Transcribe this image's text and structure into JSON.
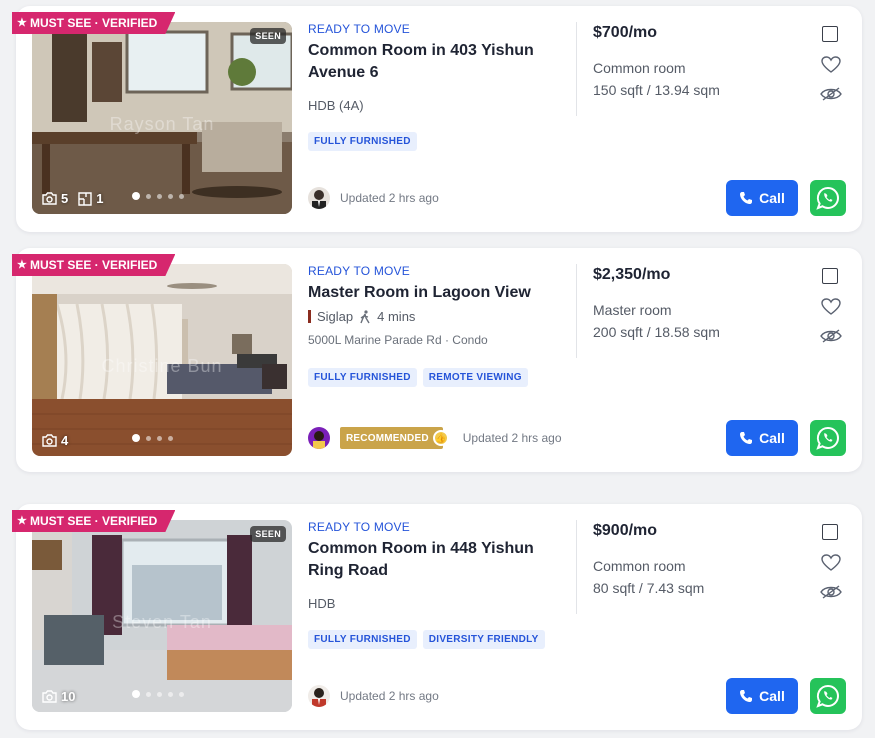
{
  "colors": {
    "accent": "#1f66f0",
    "badge": "#d6276e",
    "whatsapp": "#25c35a",
    "status": "#2554d9",
    "recommended": "#caa44a"
  },
  "listings": [
    {
      "badge": "MUST SEE · VERIFIED",
      "seen": "SEEN",
      "photo_count": "5",
      "floorplan_count": "1",
      "watermark": "Rayson Tan",
      "status": "READY TO MOVE",
      "title": "Common Room in 403 Yishun Avenue 6",
      "subtitle": "HDB (4A)",
      "tags": [
        "FULLY FURNISHED"
      ],
      "updated": "Updated 2 hrs ago",
      "price": "$700/mo",
      "room_type": "Common room",
      "size": "150 sqft / 13.94 sqm",
      "call_label": "Call"
    },
    {
      "badge": "MUST SEE · VERIFIED",
      "photo_count": "4",
      "watermark": "Christine Bun",
      "status": "READY TO MOVE",
      "title": "Master Room in Lagoon View",
      "location": "Siglap",
      "walk_time": "4 mins",
      "address": "5000L Marine Parade Rd · Condo",
      "tags": [
        "FULLY FURNISHED",
        "REMOTE VIEWING"
      ],
      "recommended": "RECOMMENDED",
      "updated": "Updated 2 hrs ago",
      "price": "$2,350/mo",
      "room_type": "Master room",
      "size": "200 sqft / 18.58 sqm",
      "call_label": "Call"
    },
    {
      "badge": "MUST SEE · VERIFIED",
      "seen": "SEEN",
      "photo_count": "10",
      "watermark": "Steven Tan",
      "status": "READY TO MOVE",
      "title": "Common Room in 448 Yishun Ring Road",
      "subtitle": "HDB",
      "tags": [
        "FULLY FURNISHED",
        "DIVERSITY FRIENDLY"
      ],
      "updated": "Updated 2 hrs ago",
      "price": "$900/mo",
      "room_type": "Common room",
      "size": "80 sqft / 7.43 sqm",
      "call_label": "Call"
    }
  ]
}
